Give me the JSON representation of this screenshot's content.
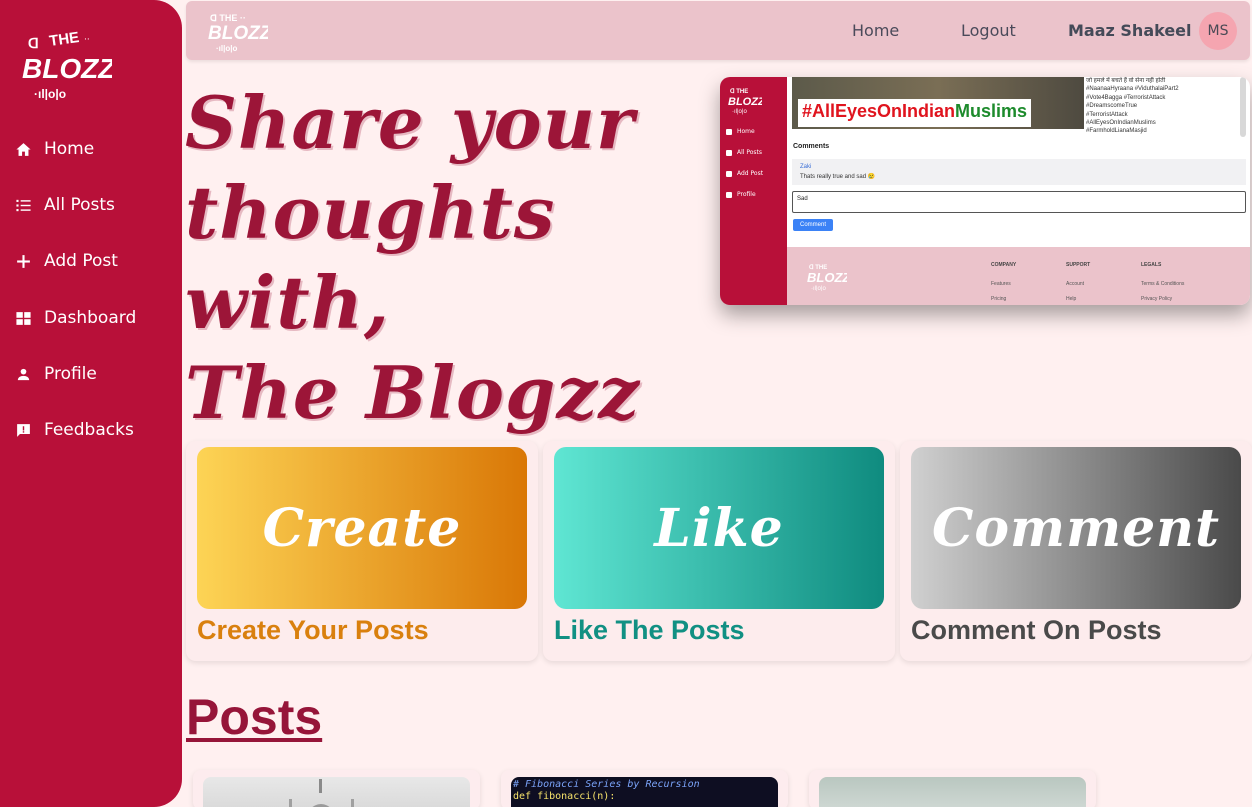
{
  "brand": {
    "name": "The Blogzz",
    "primary_color": "#b81039",
    "topbar_color": "#ebc3cb",
    "background_color": "#fff0f0"
  },
  "sidebar": {
    "items": [
      {
        "label": "Home",
        "icon": "home-icon"
      },
      {
        "label": "All Posts",
        "icon": "list-icon"
      },
      {
        "label": "Add Post",
        "icon": "plus-icon"
      },
      {
        "label": "Dashboard",
        "icon": "dashboard-icon"
      },
      {
        "label": "Profile",
        "icon": "user-icon"
      },
      {
        "label": "Feedbacks",
        "icon": "feedback-icon"
      }
    ]
  },
  "topbar": {
    "home": "Home",
    "logout": "Logout",
    "user_name": "Maaz Shakeel",
    "avatar_initials": "MS"
  },
  "hero": {
    "lines": [
      "Share your",
      "thoughts",
      "with,",
      "The Blogzz"
    ]
  },
  "preview": {
    "banner_text_red": "#AllEyesOn",
    "banner_text_mid": "Indian",
    "banner_text_green": "Muslims",
    "tags": [
      "जो हमले में बचते हैं वो सेना नहीं होती",
      "#NaanaaHyraana #ViduthalaiPart2",
      "#Vote4Bagga #TerroristAttack",
      "#DreamscomeTrue",
      "#TerroristAttack",
      "#AllEyesOnIndianMuslims",
      "#FarmholdLianaMasjid"
    ],
    "nav": [
      "Home",
      "All Posts",
      "Add Post",
      "Profile"
    ],
    "comments_heading": "Comments",
    "comment_author": "Zaki",
    "comment_text": "Thats really true and sad 😢",
    "input_value": "Sad",
    "comment_button": "Comment",
    "footer": {
      "company": {
        "heading": "COMPANY",
        "links": [
          "Features",
          "Pricing"
        ]
      },
      "support": {
        "heading": "SUPPORT",
        "links": [
          "Account",
          "Help"
        ]
      },
      "legals": {
        "heading": "LEGALS",
        "links": [
          "Terms & Conditions",
          "Privacy Policy"
        ]
      }
    }
  },
  "features": [
    {
      "word": "Create",
      "title": "Create Your Posts",
      "title_color": "#d9800e",
      "gradient": [
        "#fdd455",
        "#d97706"
      ]
    },
    {
      "word": "Like",
      "title": "Like The Posts",
      "title_color": "#119083",
      "gradient": [
        "#5fe6d3",
        "#0f8b7f"
      ]
    },
    {
      "word": "Comment",
      "title": "Comment On Posts",
      "title_color": "#4a4a4a",
      "gradient": [
        "#d0d0d0",
        "#4a4a4a"
      ]
    }
  ],
  "posts": {
    "heading": "Posts",
    "code_lines": [
      "# Fibonacci Series by Recursion",
      "def fibonacci(n):"
    ]
  }
}
